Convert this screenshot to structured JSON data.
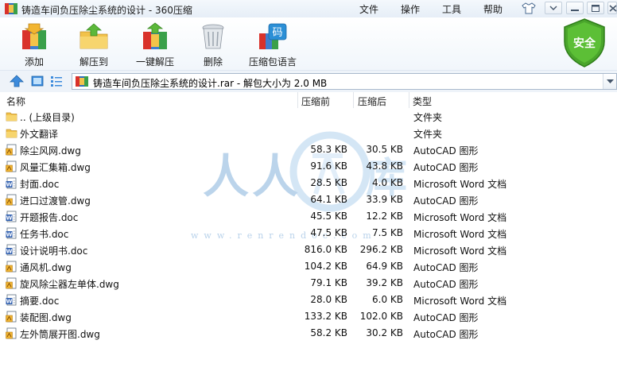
{
  "window": {
    "title": "铸造车间负压除尘系统的设计 - 360压缩",
    "menu": [
      "文件",
      "操作",
      "工具",
      "帮助"
    ]
  },
  "toolbar": {
    "add": "添加",
    "extract_to": "解压到",
    "one_click_extract": "一键解压",
    "delete": "删除",
    "compress_language": "压缩包语言"
  },
  "security_badge": "安全",
  "address": {
    "path": "铸造车间负压除尘系统的设计.rar - 解包大小为 2.0 MB"
  },
  "columns": {
    "name": "名称",
    "compressed_before": "压缩前",
    "compressed_after": "压缩后",
    "type": "类型"
  },
  "files": [
    {
      "name": ".. (上级目录)",
      "before": "",
      "after": "",
      "type": "文件夹",
      "icon": "folder-icon"
    },
    {
      "name": "外文翻译",
      "before": "",
      "after": "",
      "type": "文件夹",
      "icon": "folder-icon"
    },
    {
      "name": "除尘风网.dwg",
      "before": "58.3 KB",
      "after": "30.5 KB",
      "type": "AutoCAD 图形",
      "icon": "dwg-file-icon"
    },
    {
      "name": "风量汇集箱.dwg",
      "before": "91.6 KB",
      "after": "43.8 KB",
      "type": "AutoCAD 图形",
      "icon": "dwg-file-icon"
    },
    {
      "name": "封面.doc",
      "before": "28.5 KB",
      "after": "4.0 KB",
      "type": "Microsoft Word 文档",
      "icon": "doc-file-icon"
    },
    {
      "name": "进口过渡管.dwg",
      "before": "64.1 KB",
      "after": "33.9 KB",
      "type": "AutoCAD 图形",
      "icon": "dwg-file-icon"
    },
    {
      "name": "开题报告.doc",
      "before": "45.5 KB",
      "after": "12.2 KB",
      "type": "Microsoft Word 文档",
      "icon": "doc-file-icon"
    },
    {
      "name": "任务书.doc",
      "before": "47.5 KB",
      "after": "7.5 KB",
      "type": "Microsoft Word 文档",
      "icon": "doc-file-icon"
    },
    {
      "name": "设计说明书.doc",
      "before": "816.0 KB",
      "after": "296.2 KB",
      "type": "Microsoft Word 文档",
      "icon": "doc-file-icon"
    },
    {
      "name": "通风机.dwg",
      "before": "104.2 KB",
      "after": "64.9 KB",
      "type": "AutoCAD 图形",
      "icon": "dwg-file-icon"
    },
    {
      "name": "旋风除尘器左单体.dwg",
      "before": "79.1 KB",
      "after": "39.2 KB",
      "type": "AutoCAD 图形",
      "icon": "dwg-file-icon"
    },
    {
      "name": "摘要.doc",
      "before": "28.0 KB",
      "after": "6.0 KB",
      "type": "Microsoft Word 文档",
      "icon": "doc-file-icon"
    },
    {
      "name": "装配图.dwg",
      "before": "133.2 KB",
      "after": "102.0 KB",
      "type": "AutoCAD 图形",
      "icon": "dwg-file-icon"
    },
    {
      "name": "左外筒展开图.dwg",
      "before": "58.2 KB",
      "after": "30.2 KB",
      "type": "AutoCAD 图形",
      "icon": "dwg-file-icon"
    }
  ],
  "watermark": {
    "text": "人人文库",
    "url": "www.renrendoc.com"
  },
  "colors": {
    "accent_blue": "#2f7fd0",
    "shield_green": "#4aa52c",
    "folder_yellow": "#f2c24b"
  }
}
